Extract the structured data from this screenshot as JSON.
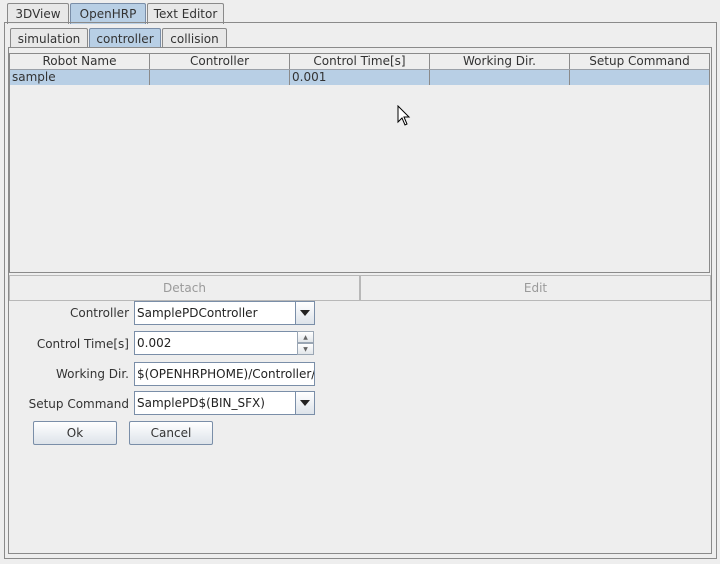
{
  "top_tabs": [
    {
      "label": "3DView",
      "active": false
    },
    {
      "label": "OpenHRP",
      "active": true
    },
    {
      "label": "Text Editor",
      "active": false
    }
  ],
  "sub_tabs": [
    {
      "label": "simulation",
      "active": false
    },
    {
      "label": "controller",
      "active": true
    },
    {
      "label": "collision",
      "active": false
    }
  ],
  "table": {
    "columns": [
      "Robot Name",
      "Controller",
      "Control Time[s]",
      "Working Dir.",
      "Setup Command"
    ],
    "rows": [
      [
        "sample",
        "",
        "0.001",
        "",
        ""
      ]
    ]
  },
  "actions": {
    "detach_label": "Detach",
    "edit_label": "Edit"
  },
  "form": {
    "controller_label": "Controller",
    "controller_value": "SamplePDController",
    "control_time_label": "Control Time[s]",
    "control_time_value": "0.002",
    "working_dir_label": "Working Dir.",
    "working_dir_value": "$(OPENHRPHOME)/Controller/r",
    "setup_command_label": "Setup Command",
    "setup_command_value": "SamplePD$(BIN_SFX)",
    "ok_label": "Ok",
    "cancel_label": "Cancel"
  },
  "colors": {
    "selection": "#b8cfe5",
    "background": "#eeeeee",
    "border": "#7a8ea8"
  }
}
